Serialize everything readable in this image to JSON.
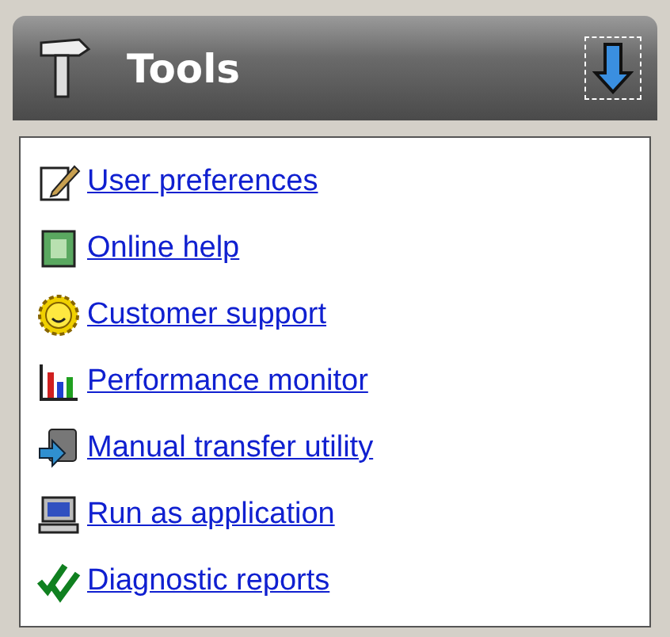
{
  "panel": {
    "title": "Tools"
  },
  "links": [
    {
      "label": "User preferences",
      "kind": "notepad"
    },
    {
      "label": "Online help",
      "kind": "help"
    },
    {
      "label": "Customer support",
      "kind": "smiley"
    },
    {
      "label": "Performance monitor",
      "kind": "chart"
    },
    {
      "label": "Manual transfer utility",
      "kind": "transfer"
    },
    {
      "label": "Run as application",
      "kind": "computer"
    },
    {
      "label": "Diagnostic reports",
      "kind": "checks"
    }
  ]
}
